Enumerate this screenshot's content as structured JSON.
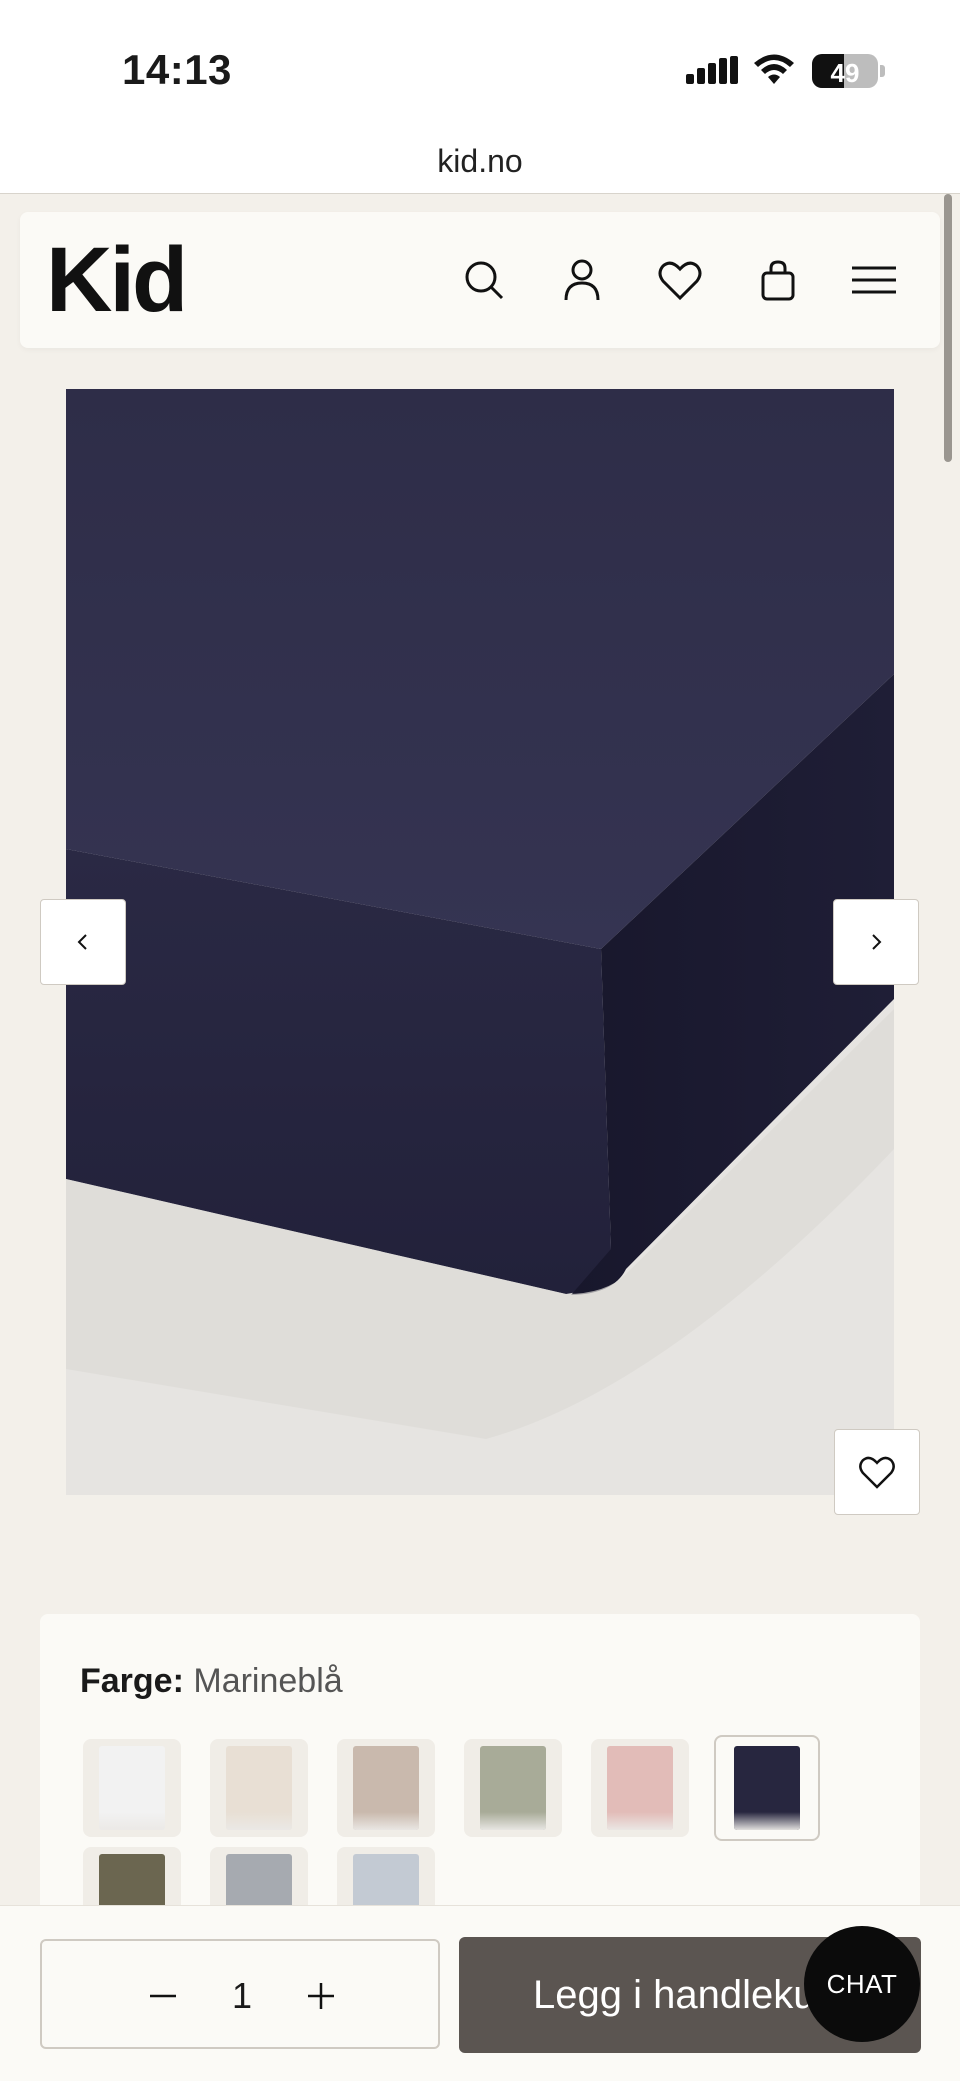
{
  "status_bar": {
    "time": "14:13",
    "battery": "49"
  },
  "browser": {
    "url": "kid.no"
  },
  "header": {
    "logo": "Kid",
    "icons": [
      "search-icon",
      "account-icon",
      "heart-icon",
      "bag-icon",
      "menu-icon"
    ]
  },
  "product": {
    "color_label": "Farge:",
    "color_value": "Marineblå",
    "image_color": "#2b2a45",
    "swatches": [
      {
        "color": "#f2f2f2",
        "selected": false
      },
      {
        "color": "#e8dfd4",
        "selected": false
      },
      {
        "color": "#c9b9ad",
        "selected": false
      },
      {
        "color": "#a8ab98",
        "selected": false
      },
      {
        "color": "#e2bcb8",
        "selected": false
      },
      {
        "color": "#27263f",
        "selected": true
      },
      {
        "color": "#6b6650",
        "selected": false
      },
      {
        "color": "#a6aab0",
        "selected": false
      },
      {
        "color": "#c3cad3",
        "selected": false
      }
    ]
  },
  "cart": {
    "quantity": "1",
    "add_label": "Legg i handlekurv",
    "chat_label": "CHAT"
  }
}
